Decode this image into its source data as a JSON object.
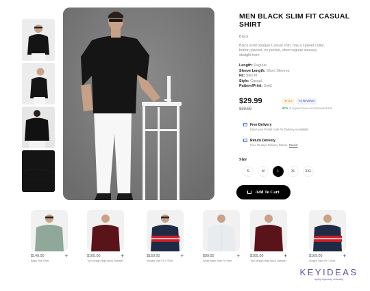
{
  "product": {
    "title": "MEN BLACK SLIM FIT CASUAL SHIRT",
    "color": "Black",
    "description": "Black solid opaque Casual shirt, has a spread collar, button placket, no pocket, short regular sleeves, straight hem",
    "specs": [
      {
        "label": "Length:",
        "value": "Regular"
      },
      {
        "label": "Sleeve Length:",
        "value": "Short Sleeves"
      },
      {
        "label": "Fit:",
        "value": "Slim fit"
      },
      {
        "label": "Style:",
        "value": "Casual"
      },
      {
        "label": "Pattern/Print:",
        "value": "Solid"
      }
    ],
    "price": "$29.99",
    "old_price": "$39.99",
    "rating": "4.2",
    "reviews": "74 Reviews",
    "buyers_pct": "97%",
    "buyers_text": "of buyers have recommended this"
  },
  "delivery": {
    "free_title": "Free Delivery",
    "free_sub": "Enter your Postal code for Delivery Availability",
    "return_title": "Return Delivery",
    "return_sub": "Free 30 days Delivery Return.",
    "return_link": "Details"
  },
  "size": {
    "label": "Size",
    "options": [
      "S",
      "M",
      "L",
      "XL",
      "XXL"
    ],
    "selected": "L"
  },
  "cart_label": "Add To Cart",
  "colors": {
    "shirt_black": "#111111",
    "maroon": "#5a1419",
    "navy": "#1f2a44",
    "red": "#c8202b",
    "sage": "#8fa89a",
    "white_shirt": "#e9ecef"
  },
  "related": [
    {
      "price": "$149.00",
      "name": "Basic Teal Shirt"
    },
    {
      "price": "$105.00",
      "name": "Turf Design High Neck Sweater"
    },
    {
      "price": "$169.00",
      "name": "Striped Slim Fit T-Shirt"
    },
    {
      "price": "$99.00",
      "name": "White Satin Slim Fit Shirt"
    },
    {
      "price": "$105.00",
      "name": "Turf Design High Neck Sweater"
    },
    {
      "price": "$169.00",
      "name": "Striped Slim Fit T-Shirt"
    }
  ],
  "brand": {
    "name": "KEYIDEAS",
    "tagline": "agility·ingenuity·reliability"
  }
}
